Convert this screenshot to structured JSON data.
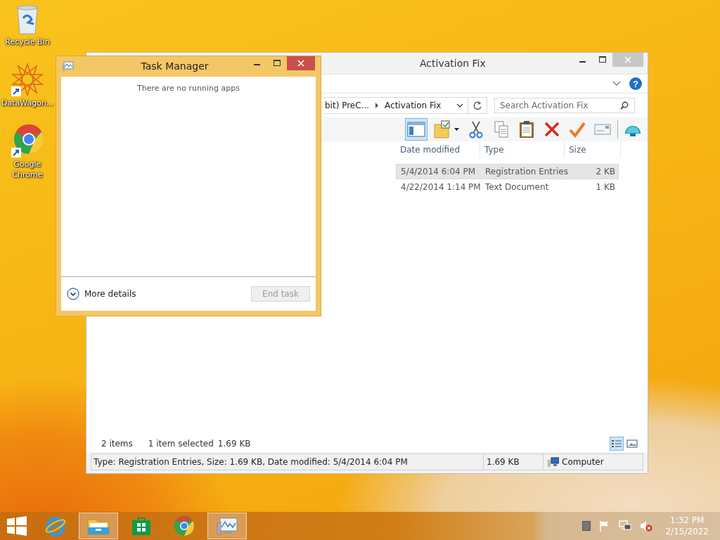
{
  "desktop_icons": [
    {
      "label": "Recycle Bin",
      "kind": "recycle",
      "shortcut": false
    },
    {
      "label": "DataWagon...",
      "kind": "star",
      "shortcut": true
    },
    {
      "label": "Google Chrome",
      "kind": "chrome",
      "shortcut": true
    }
  ],
  "explorer": {
    "title": "Activation Fix",
    "help": "?",
    "address": [
      "bit) PreC...",
      "Activation Fix"
    ],
    "search": {
      "placeholder": "Search Activation Fix"
    },
    "columns": [
      "Date modified",
      "Type",
      "Size"
    ],
    "rows": [
      {
        "date": "5/4/2014 6:04 PM",
        "type": "Registration Entries",
        "size": "2 KB",
        "selected": true
      },
      {
        "date": "4/22/2014 1:14 PM",
        "type": "Text Document",
        "size": "1 KB",
        "selected": false
      }
    ],
    "item_count": "2 items",
    "selection": "1 item selected",
    "selection_size": "1.69 KB",
    "status_bar": {
      "details": "Type: Registration Entries, Size: 1.69 KB, Date modified: 5/4/2014 6:04 PM",
      "size": "1.69 KB",
      "location": "Computer"
    }
  },
  "task_manager": {
    "title": "Task Manager",
    "message": "There are no running apps",
    "more_details": "More details",
    "end_task": {
      "label": "End task",
      "disabled": true
    }
  },
  "taskbar": {
    "apps": [
      {
        "kind": "ie",
        "active": false
      },
      {
        "kind": "explorer",
        "active": true
      },
      {
        "kind": "store",
        "active": false
      },
      {
        "kind": "chrome",
        "active": false
      },
      {
        "kind": "taskmgr",
        "active": true
      }
    ],
    "time": "1:32 PM",
    "date": "2/15/2022"
  }
}
